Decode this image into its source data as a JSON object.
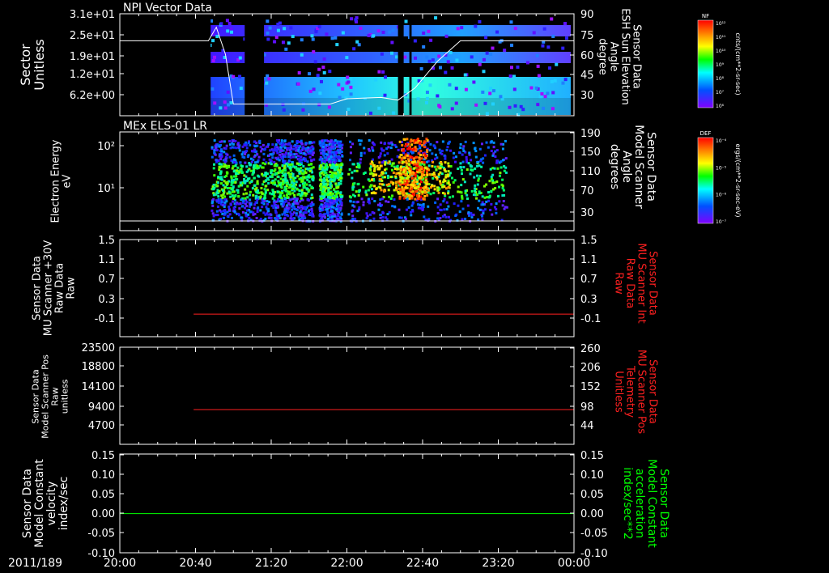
{
  "time_axis": {
    "date_label": "2011/189",
    "ticks": [
      "20:00",
      "20:40",
      "21:20",
      "22:00",
      "22:40",
      "23:20",
      "00:00"
    ],
    "range_hours": [
      20,
      24
    ]
  },
  "colors": {
    "frame": "#ffffff",
    "red_trace": "#ff2020",
    "green_trace": "#00ff00",
    "background": "#000000"
  },
  "chart_data": [
    {
      "type": "heatmap",
      "title": "NPI Vector Data",
      "ylabel_left": [
        "Sector",
        "Unitless"
      ],
      "yticks_left": [
        "3.1e+01",
        "2.5e+01",
        "1.9e+01",
        "1.2e+01",
        "6.2e+00"
      ],
      "ylabel_right": [
        "Sensor Data",
        "ESH Sun Elevation",
        "Angle",
        "degree"
      ],
      "yticks_right": [
        "90",
        "75",
        "60",
        "45",
        "30"
      ],
      "yrange_right": [
        15,
        90
      ],
      "colorbar": {
        "label": "NF",
        "unit": "cnts/(cm**2-sr-sec)",
        "ticks": [
          "10¹²",
          "10¹¹",
          "10¹⁰",
          "10⁹",
          "10⁸",
          "10⁷",
          "10⁶"
        ]
      },
      "data_gaps_hours": [
        [
          20.0,
          20.8
        ],
        [
          21.1,
          21.27
        ],
        [
          22.45,
          22.5
        ],
        [
          22.55,
          22.57
        ]
      ],
      "overlay_line": {
        "name": "ESH Sun Elevation",
        "x": [
          20.0,
          20.78,
          20.85,
          20.93,
          21.0,
          21.5,
          21.85,
          22.0,
          22.3,
          22.45,
          22.6,
          22.8,
          23.0,
          24.0
        ],
        "y": [
          70,
          70,
          80,
          60,
          23,
          23,
          23,
          27,
          28,
          26,
          35,
          55,
          70,
          70
        ]
      }
    },
    {
      "type": "heatmap",
      "title": "MEx ELS-01 LR",
      "ylabel_left": [
        "Electron Energy",
        "eV"
      ],
      "yticks_left": [
        "10²",
        "10¹"
      ],
      "ylabel_right": [
        "Sensor Data",
        "Model Scanner",
        "Angle",
        "degrees"
      ],
      "yticks_right": [
        "190",
        "150",
        "110",
        "70",
        "30"
      ],
      "yrange_right": [
        5,
        190
      ],
      "colorbar": {
        "label": "DEF",
        "unit": "ergs/(cm**2-sr-sec-eV)",
        "ticks": [
          "10⁻⁴",
          "10⁻⁵",
          "10⁻⁶",
          "10⁻⁷"
        ]
      },
      "overlay_line": {
        "name": "Model Scanner Angle",
        "x": [
          20.0,
          24.0
        ],
        "y": [
          10,
          10
        ]
      }
    },
    {
      "type": "line",
      "ylabel_left": [
        "Sensor Data",
        "MU Scanner +30V",
        "Raw Data",
        "Raw"
      ],
      "yticks_left": [
        "1.5",
        "1.1",
        "0.7",
        "0.3",
        "-0.1"
      ],
      "ylabel_right": [
        "Sensor Data",
        "MU Scanner Int",
        "Raw Data",
        "Raw"
      ],
      "yticks_right": [
        "1.5",
        "1.1",
        "0.7",
        "0.3",
        "-0.1"
      ],
      "ylim": [
        -0.4,
        1.5
      ],
      "series": [
        {
          "name": "MU Scanner Int",
          "color": "#ff2020",
          "x": [
            20.65,
            24.0
          ],
          "y": [
            -0.02,
            -0.02
          ]
        }
      ]
    },
    {
      "type": "line",
      "ylabel_left": [
        "Sensor Data",
        "Model Scanner Pos",
        "Raw",
        "unitless"
      ],
      "yticks_left": [
        "23500",
        "18800",
        "14100",
        "9400",
        "4700"
      ],
      "ylabel_right": [
        "Sensor Data",
        "MU Scanner Pos",
        "Telemetry",
        "Unitless"
      ],
      "yticks_right": [
        "260",
        "206",
        "152",
        "98",
        "44"
      ],
      "ylim_right": [
        -10,
        260
      ],
      "series": [
        {
          "name": "MU Scanner Pos",
          "color": "#ff2020",
          "x": [
            20.65,
            24.0
          ],
          "y": [
            80,
            80
          ]
        }
      ]
    },
    {
      "type": "line",
      "ylabel_left": [
        "Sensor Data",
        "Model Constant",
        "velocity",
        "index/sec"
      ],
      "yticks_left": [
        "0.15",
        "0.10",
        "0.05",
        "0.00",
        "-0.05",
        "-0.10"
      ],
      "ylabel_right": [
        "Sensor Data",
        "Model Constant",
        "acceleration",
        "index/sec**2"
      ],
      "yticks_right": [
        "0.15",
        "0.10",
        "0.05",
        "0.00",
        "-0.05",
        "-0.10"
      ],
      "ylim": [
        -0.1,
        0.15
      ],
      "series": [
        {
          "name": "Model Constant acceleration",
          "color": "#00ff00",
          "x": [
            20.0,
            24.0
          ],
          "y": [
            0.0,
            0.0
          ]
        }
      ]
    }
  ]
}
